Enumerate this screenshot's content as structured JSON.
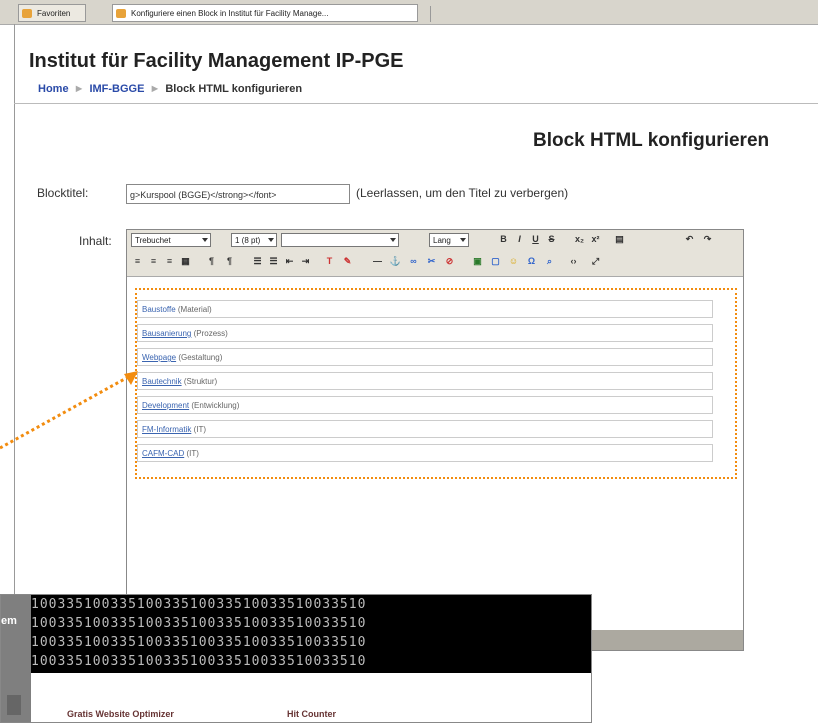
{
  "browser": {
    "tabs": [
      {
        "label": "Favoriten"
      },
      {
        "label": "Konfiguriere einen Block in Institut für Facility Manage..."
      }
    ]
  },
  "page": {
    "site_title": "Institut für Facility Management IP-PGE",
    "breadcrumb": {
      "home": "Home",
      "course": "IMF-BGGE",
      "current": "Block HTML konfigurieren"
    },
    "heading": "Block HTML konfigurieren"
  },
  "form": {
    "title_label": "Blocktitel:",
    "title_value": "g>Kurspool (BGGE)</strong></font>",
    "title_hint": "(Leerlassen, um den Titel zu verbergen)",
    "content_label": "Inhalt:"
  },
  "editor": {
    "font_family": "Trebuchet",
    "font_size": "1 (8 pt)",
    "format": "",
    "lang": "Lang",
    "rows": [
      {
        "link": "Baustoffe",
        "suffix": "(Material)"
      },
      {
        "link": "Bausanierung",
        "suffix": "(Prozess)"
      },
      {
        "link": "Webpage",
        "suffix": "(Gestaltung)"
      },
      {
        "link": "Bautechnik",
        "suffix": "(Struktur)"
      },
      {
        "link": "Development",
        "suffix": "(Entwicklung)"
      },
      {
        "link": "FM-Informatik",
        "suffix": "(IT)"
      },
      {
        "link": "CAFM-CAD",
        "suffix": "(IT)"
      }
    ]
  },
  "overlay": {
    "side_label": "em",
    "digits": "10033510033510033510033510033510033510",
    "labels": [
      "Gratis Website Optimizer",
      "Hit Counter"
    ]
  },
  "colors": {
    "accent_dotted": "#f28c0f",
    "link": "#3a64b0"
  }
}
